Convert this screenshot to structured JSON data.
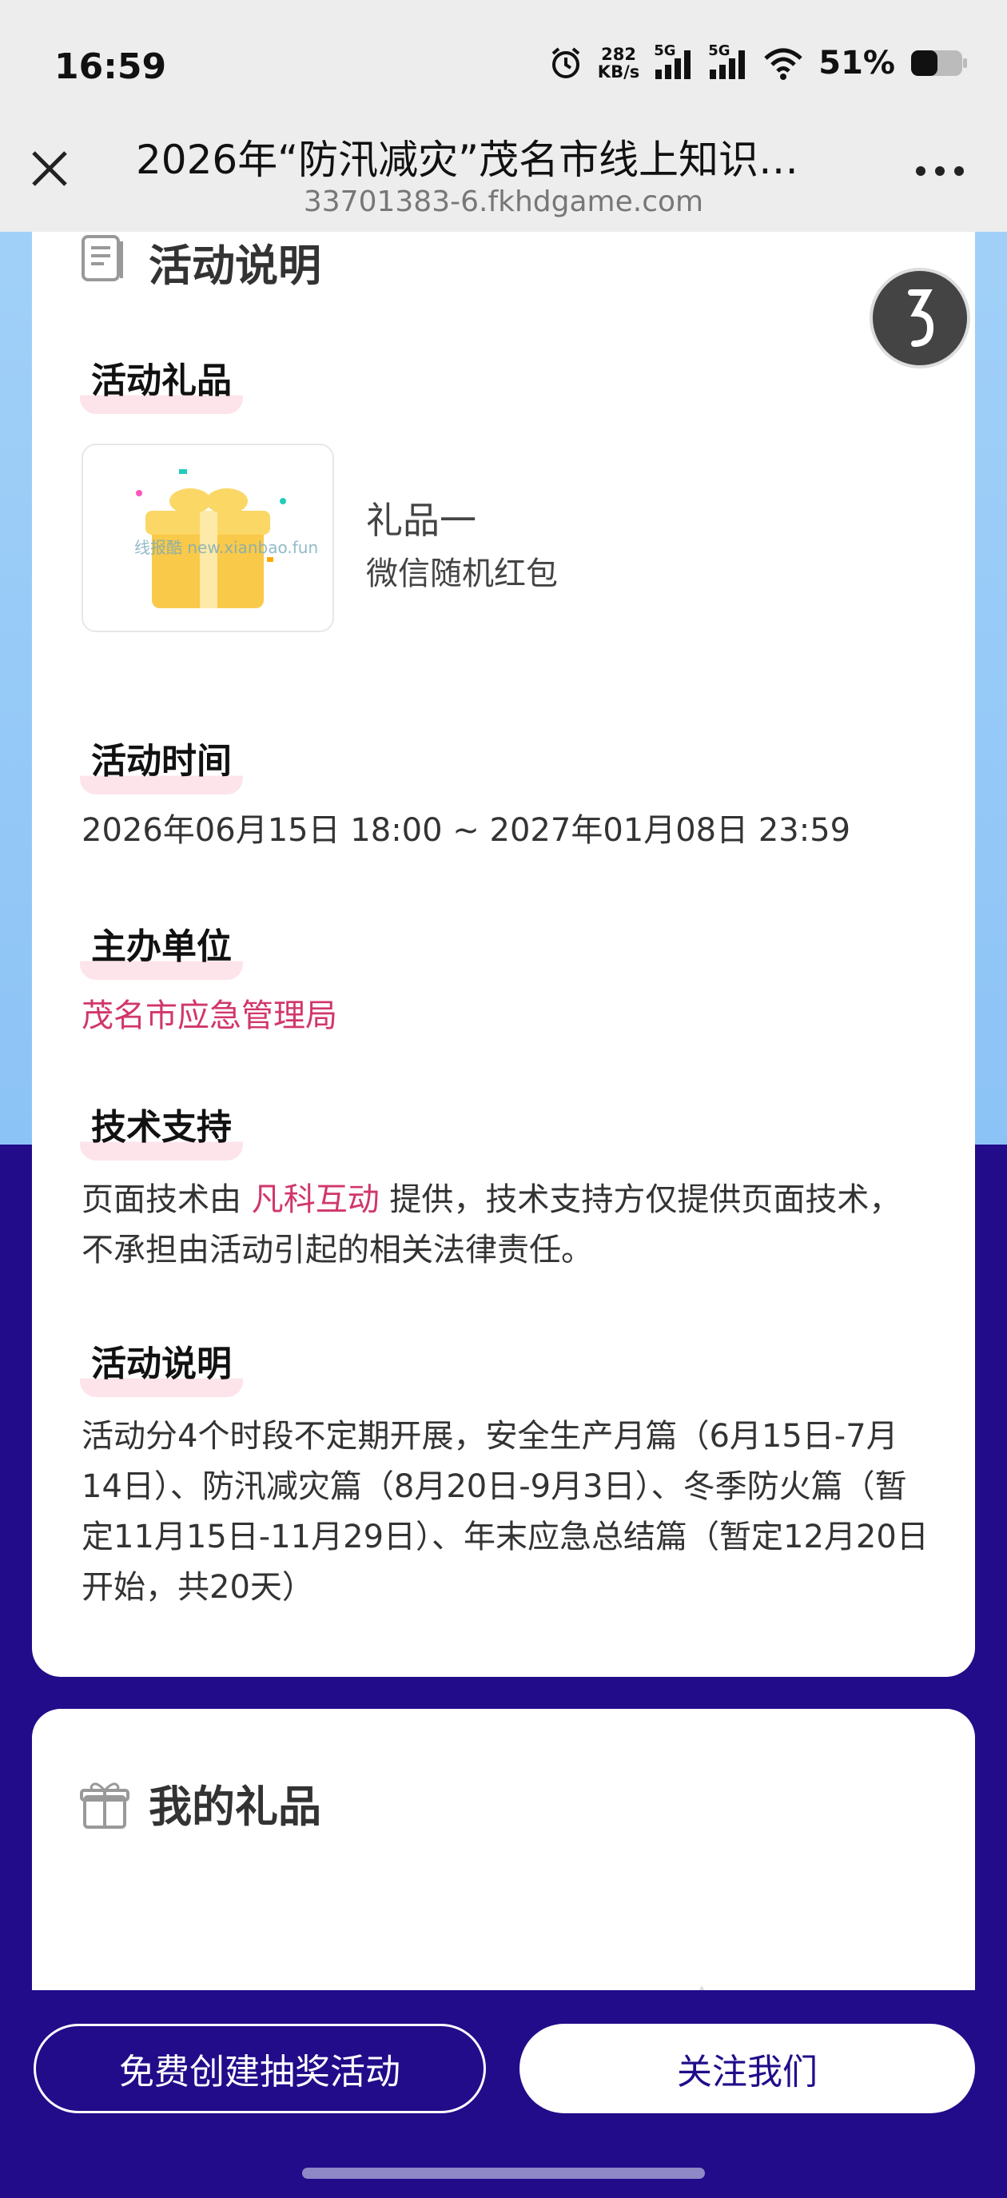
{
  "status_bar": {
    "time": "16:59",
    "net_speed_value": "282",
    "net_speed_unit": "KB/s",
    "signal_1": "5G",
    "signal_2": "5G",
    "battery": "51%"
  },
  "header": {
    "title": "2026年“防汛减灾”茂名市线上知识…",
    "url": "33701383-6.fkhdgame.com"
  },
  "info_card": {
    "title": "活动说明",
    "gifts_label": "活动礼品",
    "gift": {
      "name": "礼品一",
      "desc": "微信随机红包",
      "watermark": "线报酷 new.xianbao.fun"
    },
    "time_label": "活动时间",
    "time_value": "2026年06月15日 18:00 ~ 2027年01月08日 23:59",
    "organizer_label": "主办单位",
    "organizer_value": "茂名市应急管理局",
    "tech_label": "技术支持",
    "tech_text_prefix": "页面技术由 ",
    "tech_company": "凡科互动",
    "tech_text_suffix": " 提供，技术支持方仅提供页面技术，不承担由活动引起的相关法律责任。",
    "desc_label": "活动说明",
    "desc_text": "活动分4个时段不定期开展，安全生产月篇（6月15日-7月14日）、防汛减灾篇（8月20日-9月3日）、冬季防火篇（暂定11月15日-11月29日）、年末应急总结篇（暂定12月20日开始，共20天）"
  },
  "gifts_card": {
    "title": "我的礼品"
  },
  "bottom": {
    "create_button": "免费创建抽奖活动",
    "follow_button": "关注我们"
  },
  "colors": {
    "accent_pink": "#d1376a",
    "brand_navy": "#220c8a",
    "sky_blue": "#8cc3f6"
  }
}
